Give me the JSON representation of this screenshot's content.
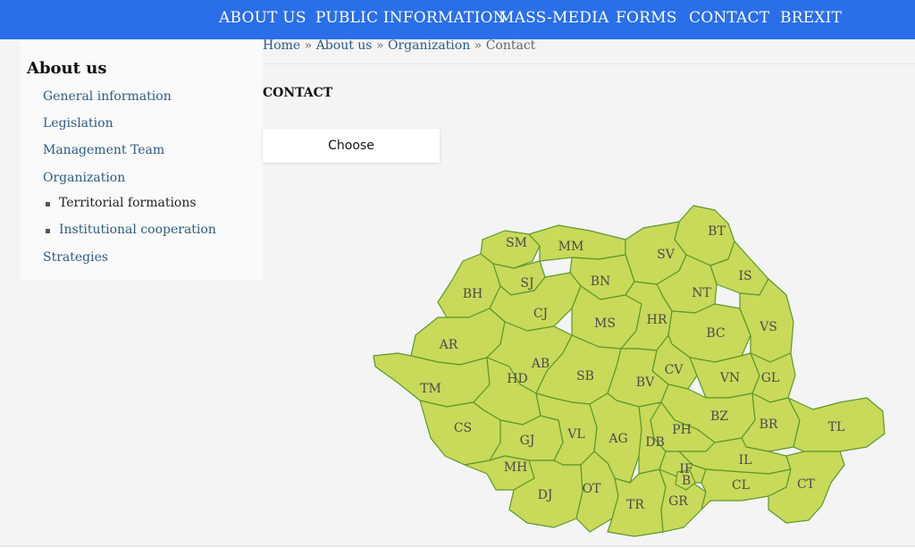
{
  "nav": {
    "items": [
      "ABOUT US",
      "PUBLIC INFORMATION",
      "MASS-MEDIA",
      "FORMS",
      "CONTACT",
      "BREXIT"
    ]
  },
  "sidebar": {
    "title": "About us",
    "items": [
      "General information",
      "Legislation",
      "Management Team",
      "Organization"
    ],
    "subitems": [
      "Territorial formations",
      "Institutional cooperation"
    ],
    "last": "Strategies"
  },
  "breadcrumb": {
    "home": "Home",
    "about": "About us",
    "org": "Organization",
    "current": "Contact",
    "sep": "»"
  },
  "page": {
    "title": "CONTACT",
    "choose": "Choose"
  },
  "map": {
    "counties": [
      "SM",
      "MM",
      "BT",
      "SV",
      "IS",
      "BN",
      "NT",
      "BH",
      "SJ",
      "CJ",
      "MS",
      "HR",
      "BC",
      "VS",
      "AR",
      "AB",
      "CV",
      "VN",
      "GL",
      "TM",
      "HD",
      "SB",
      "BV",
      "BZ",
      "BR",
      "TL",
      "CS",
      "GJ",
      "VL",
      "AG",
      "DB",
      "PH",
      "IL",
      "MH",
      "DJ",
      "OT",
      "TR",
      "GR",
      "IF",
      "B",
      "CL",
      "CT"
    ]
  },
  "colors": {
    "nav_bg": "#2a6fe9",
    "county_fill": "#c9d95a",
    "county_stroke": "#5a9a2a",
    "link": "#2b5b84"
  }
}
